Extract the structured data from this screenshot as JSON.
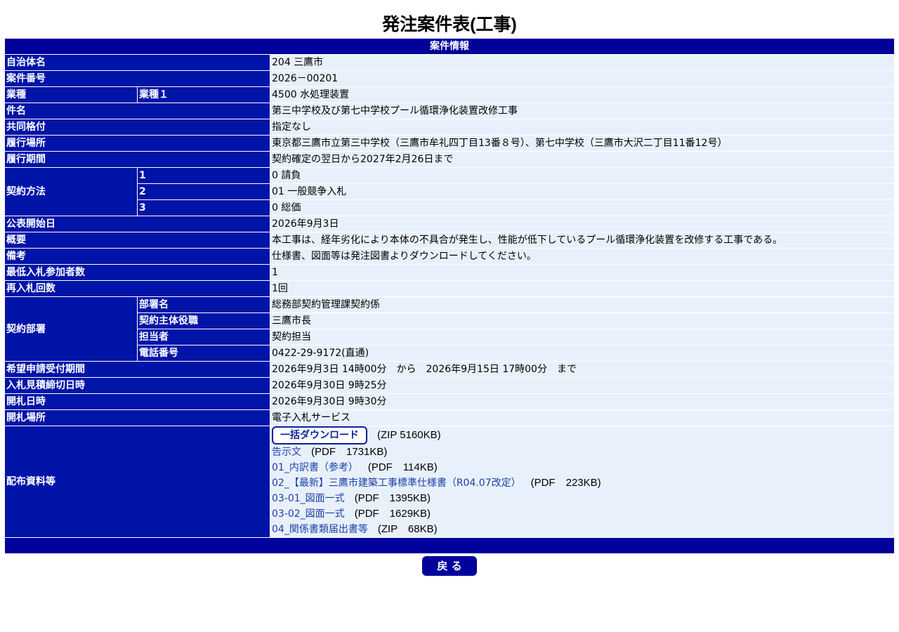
{
  "page_title": "発注案件表(工事)",
  "section_header": "案件情報",
  "rows": {
    "municipality": {
      "label": "自治体名",
      "value": "204 三鷹市"
    },
    "case_number": {
      "label": "案件番号",
      "value": "2026－00201"
    },
    "industry": {
      "label": "業種",
      "sub_label": "業種１",
      "value": "4500 水処理装置"
    },
    "subject": {
      "label": "件名",
      "value": "第三中学校及び第七中学校プール循環浄化装置改修工事"
    },
    "joint_rating": {
      "label": "共同格付",
      "value": "指定なし"
    },
    "location": {
      "label": "履行場所",
      "value": "東京都三鷹市立第三中学校（三鷹市牟礼四丁目13番８号）、第七中学校（三鷹市大沢二丁目11番12号）"
    },
    "period": {
      "label": "履行期間",
      "value": "契約確定の翌日から2027年2月26日まで"
    },
    "contract_method": {
      "label": "契約方法",
      "items": [
        {
          "sub_label": "1",
          "value": "0 請負"
        },
        {
          "sub_label": "2",
          "value": "01 一般競争入札"
        },
        {
          "sub_label": "3",
          "value": "0 総価"
        }
      ]
    },
    "publish_date": {
      "label": "公表開始日",
      "value": "2026年9月3日"
    },
    "overview": {
      "label": "概要",
      "value": "本工事は、経年劣化により本体の不具合が発生し、性能が低下しているプール循環浄化装置を改修する工事である。"
    },
    "remarks": {
      "label": "備考",
      "value": "仕様書、図面等は発注図書よりダウンロードしてください。"
    },
    "min_bidders": {
      "label": "最低入札参加者数",
      "value": "1"
    },
    "rebid_count": {
      "label": "再入札回数",
      "value": "1回"
    },
    "contract_dept": {
      "label": "契約部署",
      "items": [
        {
          "sub_label": "部署名",
          "value": "総務部契約管理課契約係"
        },
        {
          "sub_label": "契約主体役職",
          "value": "三鷹市長"
        },
        {
          "sub_label": "担当者",
          "value": "契約担当"
        },
        {
          "sub_label": "電話番号",
          "value": "0422-29-9172(直通)"
        }
      ]
    },
    "application_period": {
      "label": "希望申請受付期間",
      "value": "2026年9月3日 14時00分　から　2026年9月15日 17時00分　まで"
    },
    "bid_deadline": {
      "label": "入札見積締切日時",
      "value": "2026年9月30日 9時25分"
    },
    "opening_datetime": {
      "label": "開札日時",
      "value": "2026年9月30日 9時30分"
    },
    "opening_place": {
      "label": "開札場所",
      "value": "電子入札サービス"
    },
    "documents": {
      "label": "配布資料等",
      "bulk_button": "一括ダウンロード",
      "bulk_info": "(ZIP 5160KB)",
      "files": [
        {
          "name": "告示文",
          "info": "(PDF　1731KB)"
        },
        {
          "name": "01_内訳書（参考）",
          "info": "(PDF　114KB)"
        },
        {
          "name": "02_【最新】三鷹市建築工事標準仕様書（R04.07改定）",
          "info": "(PDF　223KB)"
        },
        {
          "name": "03-01_図面一式",
          "info": "(PDF　1395KB)"
        },
        {
          "name": "03-02_図面一式",
          "info": "(PDF　1629KB)"
        },
        {
          "name": "04_関係書類届出書等",
          "info": "(ZIP　68KB)"
        }
      ]
    }
  },
  "back_button": "戻 る",
  "colors": {
    "header_bg": "#00009b",
    "label_bg": "#0014a8",
    "value_bg": "#e8f1fb",
    "link": "#1c3fa8"
  }
}
